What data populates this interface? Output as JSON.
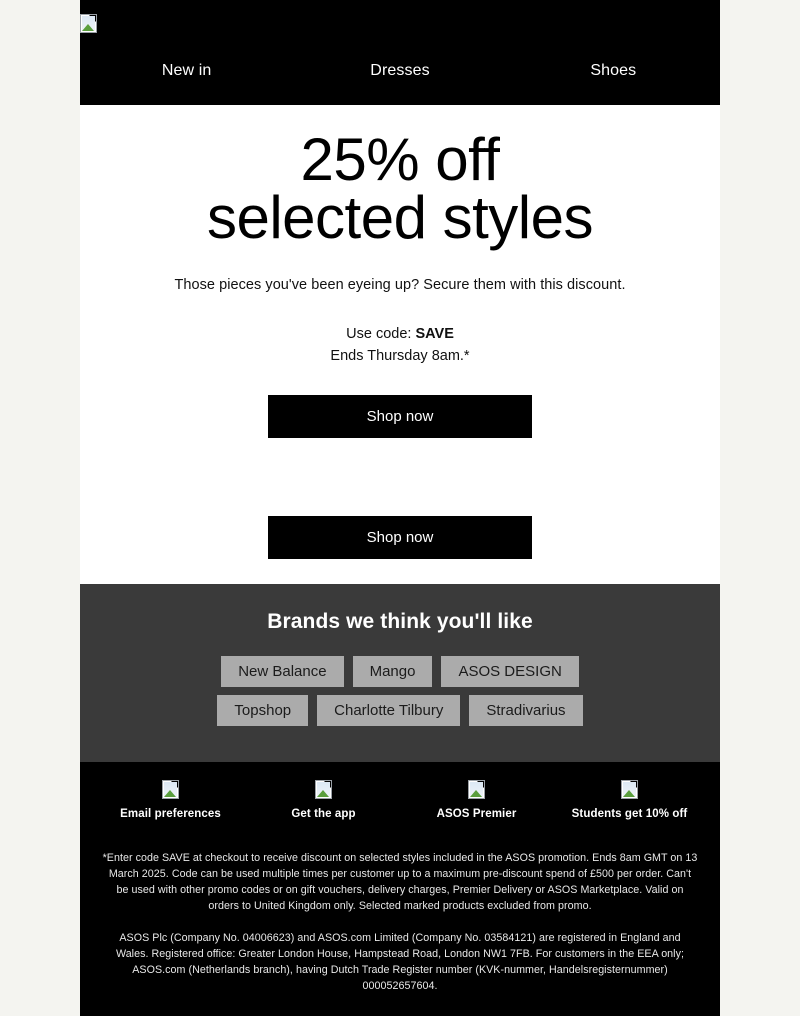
{
  "header": {
    "logo_icon": "broken-image-icon",
    "nav": [
      {
        "label": "New in"
      },
      {
        "label": "Dresses"
      },
      {
        "label": "Shoes"
      }
    ]
  },
  "hero": {
    "headline_line1": "25% off",
    "headline_line2": "selected styles",
    "subhead": "Those pieces you've been eyeing up? Secure them with this discount.",
    "use_code_prefix": "Use code:",
    "promo_code": "SAVE",
    "ends_text": "Ends Thursday 8am.*",
    "cta_primary": "Shop now",
    "cta_secondary": "Shop now"
  },
  "brands": {
    "title": "Brands we think you'll like",
    "row1": [
      {
        "label": "New Balance"
      },
      {
        "label": "Mango"
      },
      {
        "label": "ASOS DESIGN"
      }
    ],
    "row2": [
      {
        "label": "Topshop"
      },
      {
        "label": "Charlotte Tilbury"
      },
      {
        "label": "Stradivarius"
      }
    ]
  },
  "footer": {
    "links": [
      {
        "label": "Email preferences",
        "icon": "broken-image-icon"
      },
      {
        "label": "Get the app",
        "icon": "broken-image-icon"
      },
      {
        "label": "ASOS Premier",
        "icon": "broken-image-icon"
      },
      {
        "label": "Students get 10% off",
        "icon": "broken-image-icon"
      }
    ],
    "terms": "*Enter code SAVE at checkout to receive discount on selected styles included in the ASOS promotion. Ends 8am GMT on 13 March 2025. Code can be used multiple times per customer up to a maximum pre-discount spend of £500 per order. Can't be used with other promo codes or on gift vouchers, delivery charges, Premier Delivery or ASOS Marketplace. Valid on orders to United Kingdom only. Selected marked products excluded from promo.",
    "company_info": "ASOS Plc (Company No. 04006623) and ASOS.com Limited (Company No. 03584121) are registered in England and Wales. Registered office: Greater London House, Hampstead Road, London NW1 7FB. For customers in the EEA only; ASOS.com (Netherlands branch), having Dutch Trade Register number (KVK-nummer, Handelsregisternummer) 000052657604."
  },
  "colors": {
    "page_background": "#f4f4f0",
    "header_background": "#000000",
    "hero_background": "#ffffff",
    "brands_background": "#3a3a3a",
    "footer_background": "#000000",
    "pill_background": "#ababab",
    "cta_background": "#000000"
  }
}
